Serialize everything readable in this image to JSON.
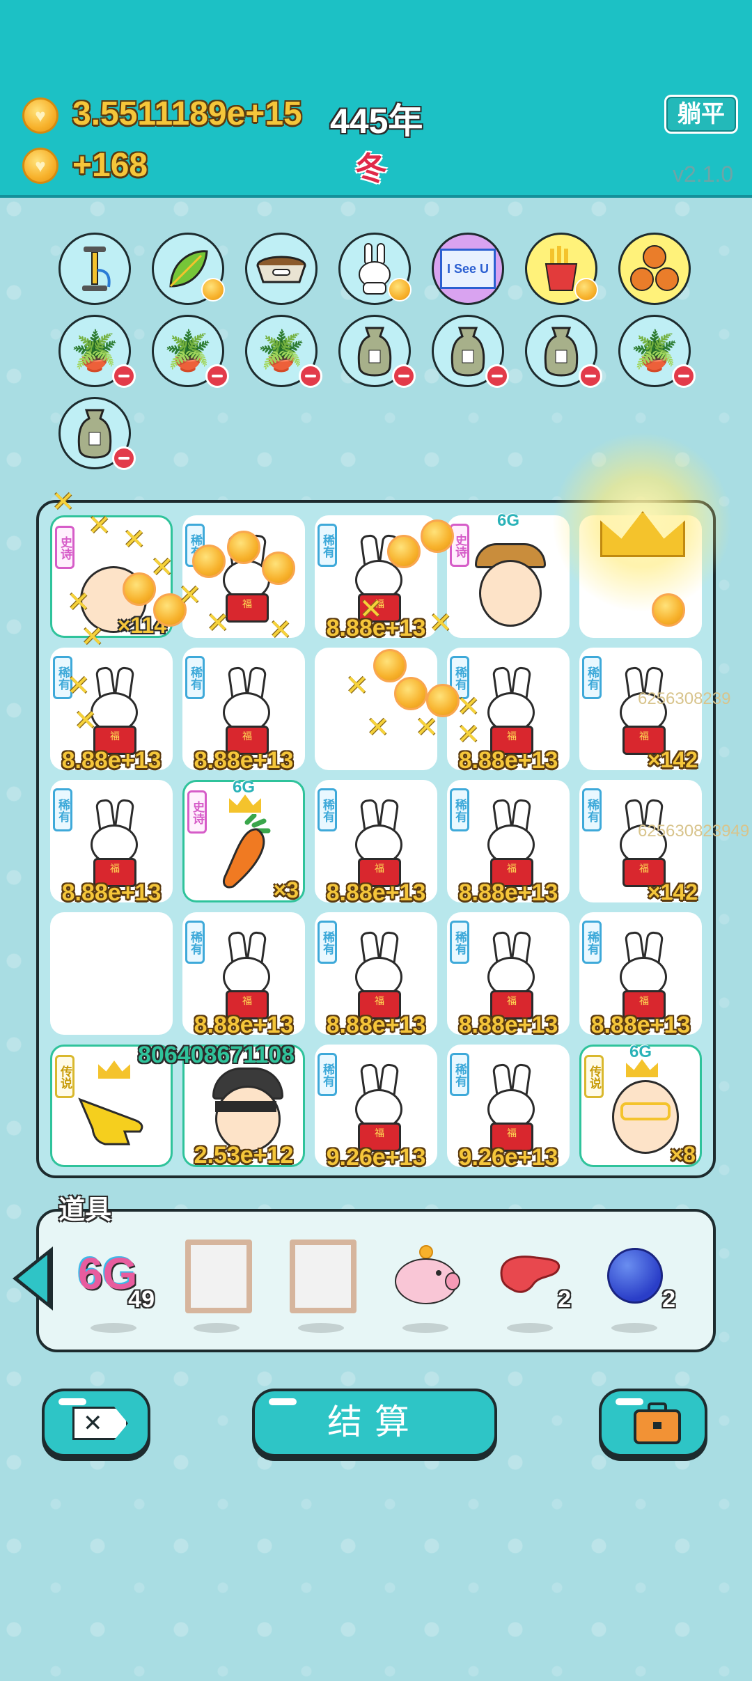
{
  "header": {
    "coins": "3.5511189e+15",
    "year": "445年",
    "income": "+168",
    "season": "冬",
    "lie_flat_label": "躺平",
    "version": "v2.1.0"
  },
  "items_row1": [
    "pump-icon",
    "leaf-icon",
    "dog-bowl-icon",
    "bunny-icon",
    "see-u-card-icon",
    "fries-icon",
    "basketballs-icon"
  ],
  "items_see_u_text": "I See U",
  "items_row2": [
    "flower-pot-icon",
    "flower-pot-icon",
    "flower-pot-icon",
    "sack-icon",
    "sack-icon",
    "sack-icon",
    "flower-pot-icon"
  ],
  "items_row3": [
    "sack-icon"
  ],
  "board": {
    "tag_6g": "6G",
    "rarity_rare": "稀有",
    "rarity_epic": "史诗",
    "rarity_legend": "传说",
    "r1": {
      "c1_count": "×114",
      "c3_val": "8.88e+13"
    },
    "r2": {
      "c1": "8.88e+13",
      "c2": "8.88e+13",
      "c4": "8.88e+13",
      "c5": "×142",
      "float_num": "6256308239"
    },
    "r3": {
      "c1": "8.88e+13",
      "c2": "×3",
      "c3": "8.88e+13",
      "c4": "8.88e+13",
      "c5": "×142",
      "float_num": "625630823949"
    },
    "r4": {
      "c2": "8.88e+13",
      "c3": "8.88e+13",
      "c4": "8.88e+13",
      "c5": "8.88e+13"
    },
    "r5": {
      "big_num": "806408671108",
      "c2": "2.53e+12",
      "c3": "9.26e+13",
      "c4": "9.26e+13",
      "c5": "×8"
    }
  },
  "tools": {
    "label": "道具",
    "t1_text": "6G",
    "t1_count": "49",
    "t5_count": "2",
    "t6_count": "2"
  },
  "buttons": {
    "close_icon": "✕",
    "settle_label": "结算",
    "briefcase_icon": "briefcase-icon"
  }
}
